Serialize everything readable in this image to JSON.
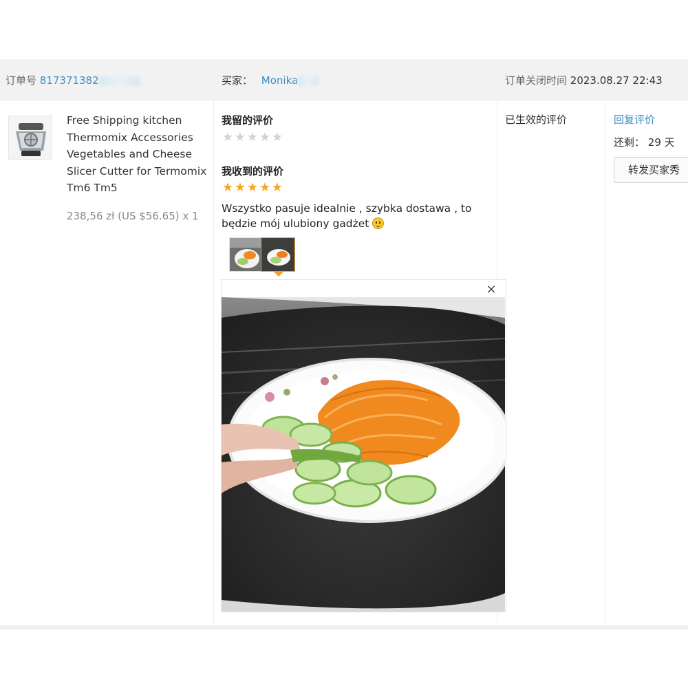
{
  "header": {
    "order_label": "订单号",
    "order_number": "817371382",
    "buyer_label": "买家：",
    "buyer_name": "Monika",
    "closed_label": "订单关闭时间",
    "closed_time": "2023.08.27 22:43"
  },
  "product": {
    "icon": "food-processor-image",
    "title": "Free Shipping kitchen Thermomix Accessories Vegetables and Cheese Slicer Cutter for Termomix Tm6 Tm5",
    "price": "238,56 zł (US $56.65) x 1"
  },
  "my_review": {
    "title": "我留的评价",
    "stars": 0,
    "star_count": 5
  },
  "received_review": {
    "title": "我收到的评价",
    "stars": 5,
    "text": "Wszystko pasuje idealnie , szybka dostawa , to będzie mój ulubiony gadżet",
    "emoji_icon": "smiley-icon",
    "thumbnails": [
      "photo-thumbnail-1",
      "photo-thumbnail-2"
    ],
    "active_thumbnail": 2,
    "close_icon": "×"
  },
  "status": {
    "text": "已生效的评价"
  },
  "actions": {
    "reply_label": "回复评价",
    "remaining_label": "还剩：",
    "remaining_value": "29 天",
    "share_label": "转发买家秀"
  },
  "colors": {
    "link": "#3a8fc4",
    "star_full": "#f5a623",
    "star_empty": "#d2d2d2",
    "header_bg": "#f2f2f2",
    "active_border": "#f0a030"
  }
}
